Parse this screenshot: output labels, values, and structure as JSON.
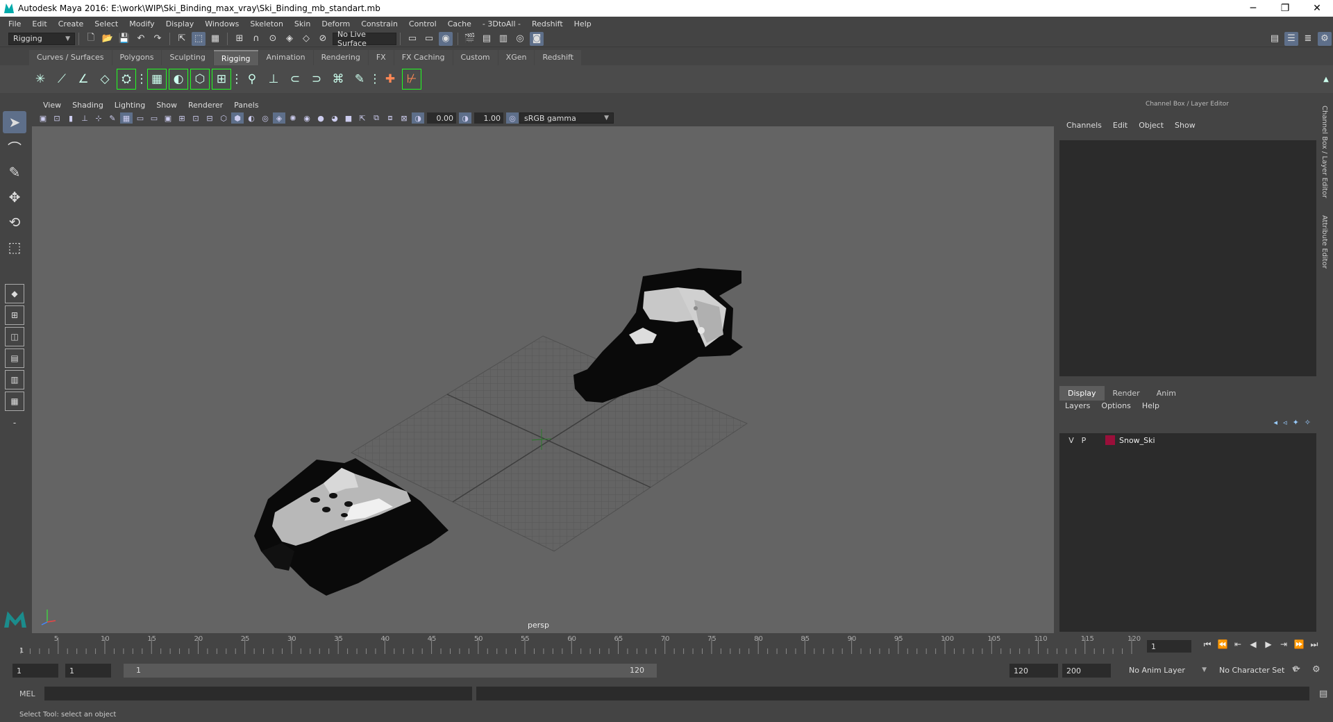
{
  "titlebar": {
    "title": "Autodesk Maya 2016: E:\\work\\WIP\\Ski_Binding_max_vray\\Ski_Binding_mb_standart.mb",
    "min": "─",
    "restore": "❐",
    "close": "✕"
  },
  "menu": [
    "File",
    "Edit",
    "Create",
    "Select",
    "Modify",
    "Display",
    "Windows",
    "Skeleton",
    "Skin",
    "Deform",
    "Constrain",
    "Control",
    "Cache",
    "- 3DtoAll -",
    "Redshift",
    "Help"
  ],
  "statusline": {
    "mode": "Rigging",
    "live_surface": "No Live Surface"
  },
  "shelf_tabs": [
    "Curves / Surfaces",
    "Polygons",
    "Sculpting",
    "Rigging",
    "Animation",
    "Rendering",
    "FX",
    "FX Caching",
    "Custom",
    "XGen",
    "Redshift"
  ],
  "shelf_active": "Rigging",
  "panel_menu": [
    "View",
    "Shading",
    "Lighting",
    "Show",
    "Renderer",
    "Panels"
  ],
  "panel_fields": {
    "exposure": "0.00",
    "gamma": "1.00",
    "colorspace": "sRGB gamma"
  },
  "viewport": {
    "camera": "persp"
  },
  "channel_box": {
    "title": "Channel Box / Layer Editor",
    "menu": [
      "Channels",
      "Edit",
      "Object",
      "Show"
    ]
  },
  "layer_editor": {
    "tabs": [
      "Display",
      "Render",
      "Anim"
    ],
    "active_tab": "Display",
    "menu": [
      "Layers",
      "Options",
      "Help"
    ],
    "layers": [
      {
        "v": "V",
        "p": "P",
        "name": "Snow_Ski",
        "color": "#9a0f3a"
      }
    ]
  },
  "side_tabs": [
    "Channel Box / Layer Editor",
    "Attribute Editor"
  ],
  "timeline": {
    "start": 1,
    "end": 120,
    "ticks": [
      5,
      10,
      15,
      20,
      25,
      30,
      35,
      40,
      45,
      50,
      55,
      60,
      65,
      70,
      75,
      80,
      85,
      90,
      95,
      100,
      105,
      110,
      115,
      120
    ],
    "current": "1"
  },
  "range": {
    "start": "1",
    "start2": "1",
    "slider_start": "1",
    "slider_end": "120",
    "end": "120",
    "end2": "200",
    "anim_layer": "No Anim Layer",
    "char_set": "No Character Set"
  },
  "cmdline": {
    "label": "MEL"
  },
  "helpline": {
    "text": "Select Tool: select an object"
  }
}
